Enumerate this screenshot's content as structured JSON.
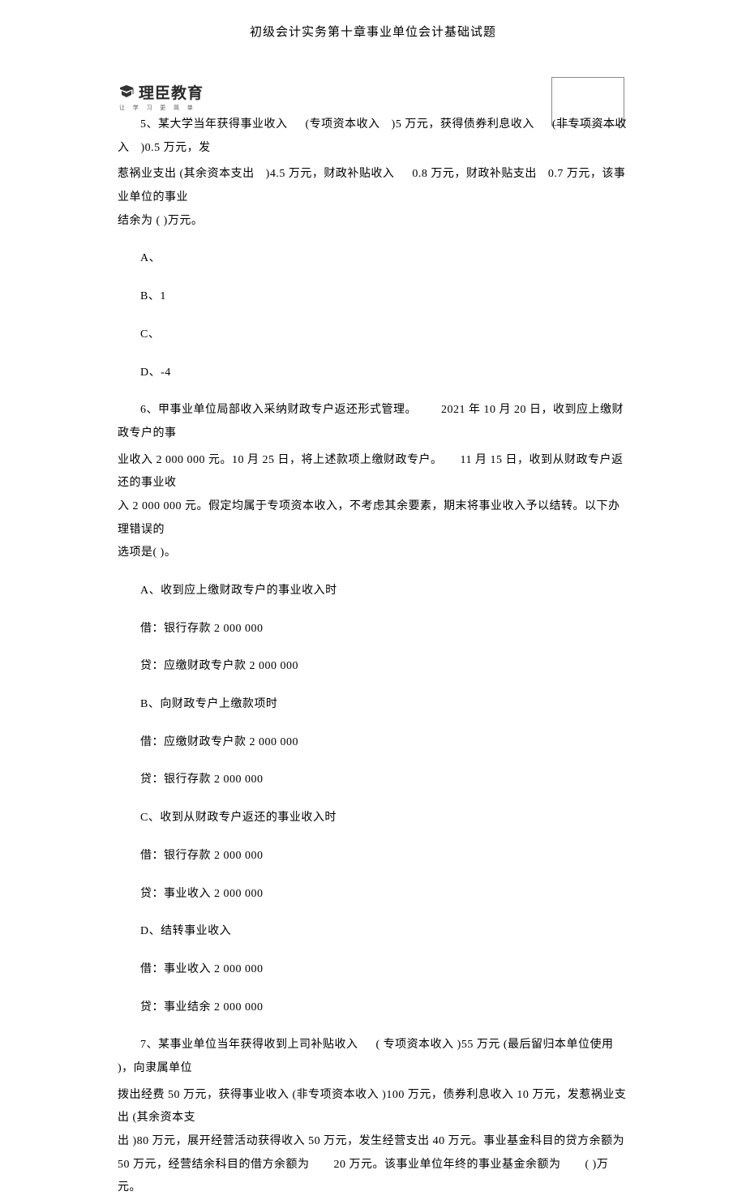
{
  "pageTitle": "初级会计实务第十章事业单位会计基础试题",
  "logo": {
    "main": "理臣教育",
    "sub": "让 学 习 更 简 单"
  },
  "q5": {
    "prefix": "5、某大学当年获得事业收入",
    "s1": "(专项资本收入",
    "s2": ")5 万元，获得债券利息收入",
    "s3": "(非专项资本收入",
    "s4": ")0.5 万元，发",
    "line2a": "惹祸业支出 (其余资本支出",
    "line2b": ")4.5 万元，财政补贴收入",
    "line2c": "0.8 万元，财政补贴支出",
    "line2d": "0.7 万元，该事业单位的事业",
    "line3": "结余为 (    )万元。",
    "optA": "A、",
    "optB": "B、1",
    "optC": "C、",
    "optD": "D、-4"
  },
  "q6": {
    "line1a": "6、甲事业单位局部收入采纳财政专户返还形式管理。",
    "line1b": "2021 年 10 月 20 日，收到应上缴财政专户的事",
    "line2a": "业收入 2 000 000 元。10 月 25 日，将上述款项上缴财政专户。",
    "line2b": "11 月  15 日，收到从财政专户返还的事业收",
    "line3": "入 2 000 000 元。假定均属于专项资本收入，不考虑其余要素，期末将事业收入予以结转。以下办理错误的",
    "line4": "选项是( )。",
    "optA": "A、收到应上缴财政专户的事业收入时",
    "a_d1": "借：银行存款    2 000 000",
    "a_c1": "贷：应缴财政专户款    2 000 000",
    "optB": "B、向财政专户上缴款项时",
    "b_d1": "借：应缴财政专户款    2 000 000",
    "b_c1": "贷：银行存款    2 000 000",
    "optC": "C、收到从财政专户返还的事业收入时",
    "c_d1": "借：银行存款    2 000 000",
    "c_c1": "贷：事业收入    2 000 000",
    "optD": "D、结转事业收入",
    "d_d1": "借：事业收入     2 000 000",
    "d_c1": "贷：事业结余    2 000 000"
  },
  "q7": {
    "line1a": "7、某事业单位当年获得收到上司补贴收入",
    "line1b": "( 专项资本收入 )55 万元 (最后留归本单位使用",
    "line1c": ")，向隶属单位",
    "line2": "拨出经费 50 万元，获得事业收入 (非专项资本收入 )100 万元，债券利息收入 10 万元，发惹祸业支出 (其余资本支",
    "line3": "出 )80 万元，展开经营活动获得收入 50 万元，发生经营支出 40 万元。事业基金科目的贷方余额为",
    "line4a": "50 万元，经营结余科目的借方余额为",
    "line4b": "20 万元。该事业单位年终的事业基金余额为",
    "line4c": "(    )万元。"
  }
}
